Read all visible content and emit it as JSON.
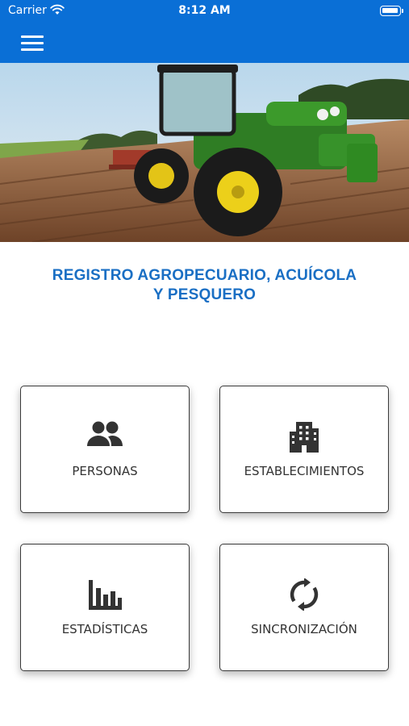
{
  "status_bar": {
    "carrier": "Carrier",
    "time": "8:12 AM"
  },
  "header": {
    "menu_icon": "hamburger-menu-icon",
    "background_color": "#0a6fd6"
  },
  "title": {
    "line1": "REGISTRO AGROPECUARIO, ACUÍCOLA",
    "line2": "Y PESQUERO",
    "color": "#1a6fc4"
  },
  "tiles": [
    {
      "label": "PERSONAS",
      "icon": "people-icon"
    },
    {
      "label": "ESTABLECIMIENTOS",
      "icon": "building-icon"
    },
    {
      "label": "ESTADÍSTICAS",
      "icon": "bar-chart-icon"
    },
    {
      "label": "SINCRONIZACIÓN",
      "icon": "sync-icon"
    }
  ]
}
